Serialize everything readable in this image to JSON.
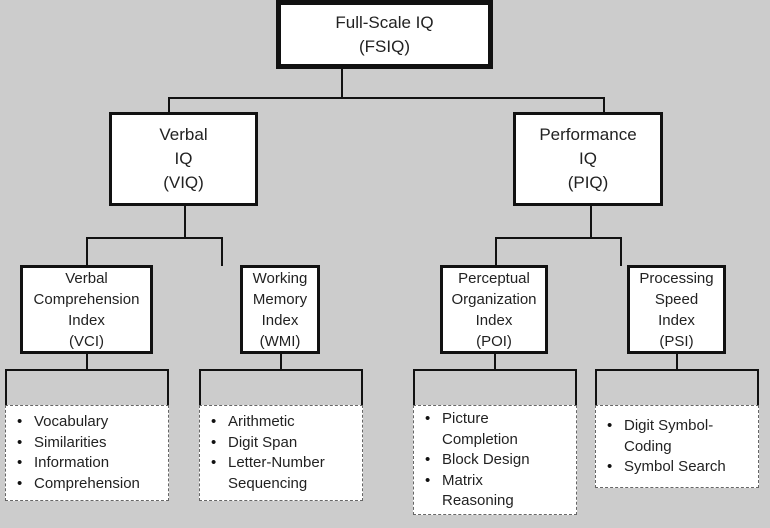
{
  "root": {
    "line1": "Full-Scale IQ",
    "line2": "(FSIQ)"
  },
  "verbal": {
    "line1": "Verbal",
    "line2": "IQ",
    "line3": "(VIQ)"
  },
  "performance": {
    "line1": "Performance",
    "line2": "IQ",
    "line3": "(PIQ)"
  },
  "indices": [
    {
      "line1": "Verbal",
      "line2": "Comprehension",
      "line3": "Index",
      "line4": "(VCI)",
      "subtests": [
        "Vocabulary",
        "Similarities",
        "Information",
        "Comprehension"
      ]
    },
    {
      "line1": "Working",
      "line2": "Memory",
      "line3": "Index",
      "line4": "(WMI)",
      "subtests": [
        "Arithmetic",
        "Digit Span",
        "Letter-Number Sequencing"
      ]
    },
    {
      "line1": "Perceptual",
      "line2": "Organization",
      "line3": "Index",
      "line4": "(POI)",
      "subtests": [
        "Picture Completion",
        "Block Design",
        "Matrix Reasoning"
      ]
    },
    {
      "line1": "Processing",
      "line2": "Speed",
      "line3": "Index",
      "line4": "(PSI)",
      "subtests": [
        "Digit Symbol-Coding",
        "Symbol Search"
      ]
    }
  ]
}
